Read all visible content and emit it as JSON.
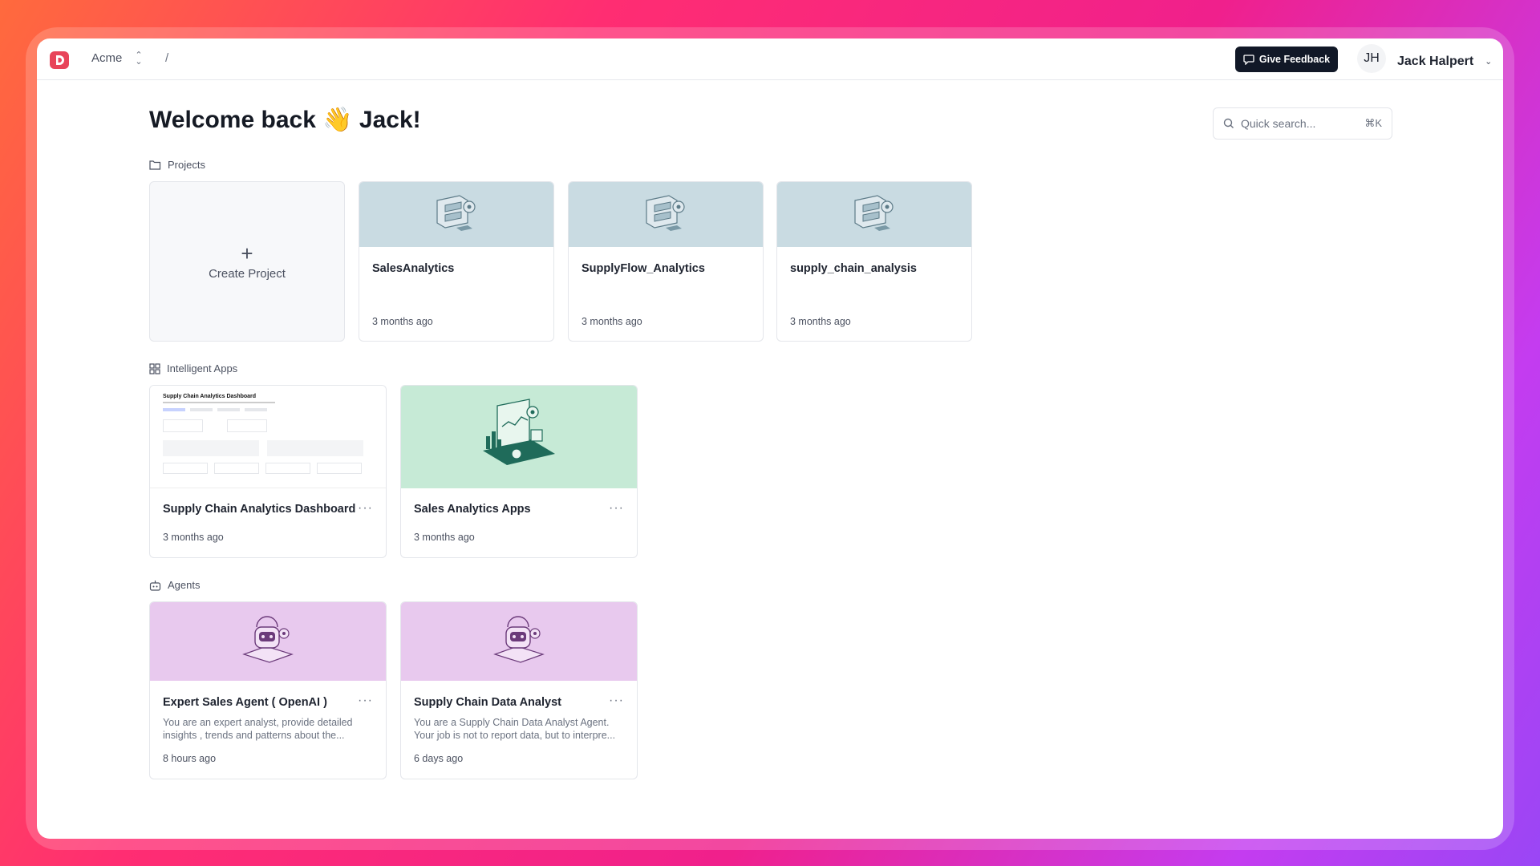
{
  "header": {
    "org_name": "Acme",
    "breadcrumb_sep": "/",
    "feedback_label": "Give Feedback",
    "user_initials": "JH",
    "user_name": "Jack Halpert"
  },
  "welcome": "Welcome back 👋 Jack!",
  "search": {
    "placeholder": "Quick search...",
    "shortcut": "⌘K"
  },
  "sections": {
    "projects": "Projects",
    "apps": "Intelligent Apps",
    "agents": "Agents"
  },
  "create_project": {
    "plus": "+",
    "label": "Create Project"
  },
  "projects": [
    {
      "name": "SalesAnalytics",
      "time": "3 months ago"
    },
    {
      "name": "SupplyFlow_Analytics",
      "time": "3 months ago"
    },
    {
      "name": "supply_chain_analysis",
      "time": "3 months ago"
    }
  ],
  "apps": [
    {
      "name": "Supply Chain Analytics Dashboard",
      "time": "3 months ago",
      "preview_title": "Supply Chain Analytics Dashboard"
    },
    {
      "name": "Sales Analytics Apps",
      "time": "3 months ago"
    }
  ],
  "agents": [
    {
      "name": "Expert Sales Agent ( OpenAI )",
      "desc": "You are an expert analyst, provide detailed insights , trends and patterns about the...",
      "time": "8 hours ago"
    },
    {
      "name": "Supply Chain Data Analyst",
      "desc": "You are a Supply Chain Data Analyst Agent. Your job is not to report data, but to interpre...",
      "time": "6 days ago"
    }
  ],
  "more_label": "···",
  "colors": {
    "project_banner": "#c9dbe2",
    "app_banner": "#c6ead6",
    "agent_banner": "#e8c9ee",
    "logo": "#e8445a"
  }
}
